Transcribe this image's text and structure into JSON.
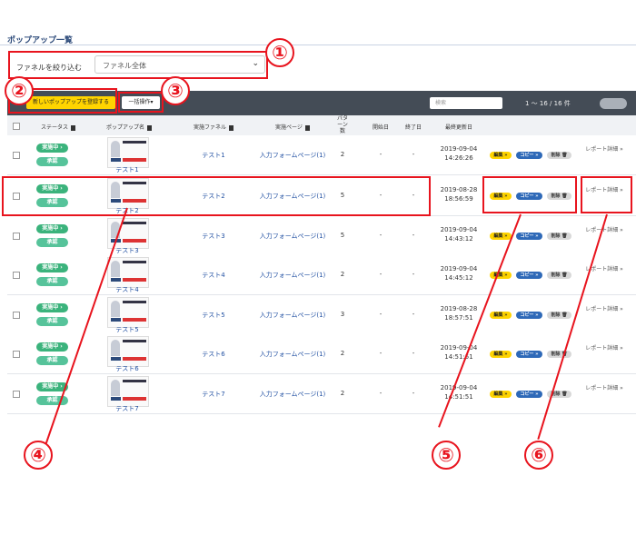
{
  "page": {
    "title": "ポップアップ一覧"
  },
  "filter": {
    "label": "ファネルを絞り込む",
    "value": "ファネル全体"
  },
  "toolbar": {
    "register_label": "新しいポップアップを登録する",
    "bulk_label": "一括操作",
    "search_placeholder": "検索",
    "pagination": "1 〜 16 / 16 件"
  },
  "table": {
    "columns": [
      "ステータス",
      "ポップアップ名",
      "実施ファネル",
      "実施ページ",
      "パターン数",
      "開始日",
      "終了日",
      "最終更新日"
    ],
    "rows": [
      {
        "status": "実施中 ›",
        "approval": "承認",
        "name": "テスト1",
        "funnel": "テスト1",
        "page": "入力フォームページ(1)",
        "patterns": "2",
        "start": "-",
        "end": "-",
        "updated_date": "2019-09-04",
        "updated_time": "14:26:26"
      },
      {
        "status": "実施中 ›",
        "approval": "承認",
        "name": "テスト2",
        "funnel": "テスト2",
        "page": "入力フォームページ(1)",
        "patterns": "5",
        "start": "-",
        "end": "-",
        "updated_date": "2019-08-28",
        "updated_time": "18:56:59"
      },
      {
        "status": "実施中 ›",
        "approval": "承認",
        "name": "テスト3",
        "funnel": "テスト3",
        "page": "入力フォームページ(1)",
        "patterns": "5",
        "start": "-",
        "end": "-",
        "updated_date": "2019-09-04",
        "updated_time": "14:43:12"
      },
      {
        "status": "実施中 ›",
        "approval": "承認",
        "name": "テスト4",
        "funnel": "テスト4",
        "page": "入力フォームページ(1)",
        "patterns": "2",
        "start": "-",
        "end": "-",
        "updated_date": "2019-09-04",
        "updated_time": "14:45:12"
      },
      {
        "status": "実施中 ›",
        "approval": "承認",
        "name": "テスト5",
        "funnel": "テスト5",
        "page": "入力フォームページ(1)",
        "patterns": "3",
        "start": "-",
        "end": "-",
        "updated_date": "2019-08-28",
        "updated_time": "18:57:51"
      },
      {
        "status": "実施中 ›",
        "approval": "承認",
        "name": "テスト6",
        "funnel": "テスト6",
        "page": "入力フォームページ(1)",
        "patterns": "2",
        "start": "-",
        "end": "-",
        "updated_date": "2019-09-04",
        "updated_time": "14:51:51"
      },
      {
        "status": "実施中 ›",
        "approval": "承認",
        "name": "テスト7",
        "funnel": "テスト7",
        "page": "入力フォームページ(1)",
        "patterns": "2",
        "start": "-",
        "end": "-",
        "updated_date": "2019-09-04",
        "updated_time": "14:51:51"
      }
    ],
    "actions": {
      "edit": "編集 »",
      "copy": "コピー »",
      "delete": "削除 🗑",
      "report": "レポート詳細 »"
    }
  },
  "annotations": [
    "①",
    "②",
    "③",
    "④",
    "⑤",
    "⑥"
  ],
  "colors": {
    "accent": "#e8141e",
    "yellow": "#ffd400",
    "status_green": "#3bb37c",
    "link_blue": "#2452a3",
    "toolbar": "#444c56"
  }
}
